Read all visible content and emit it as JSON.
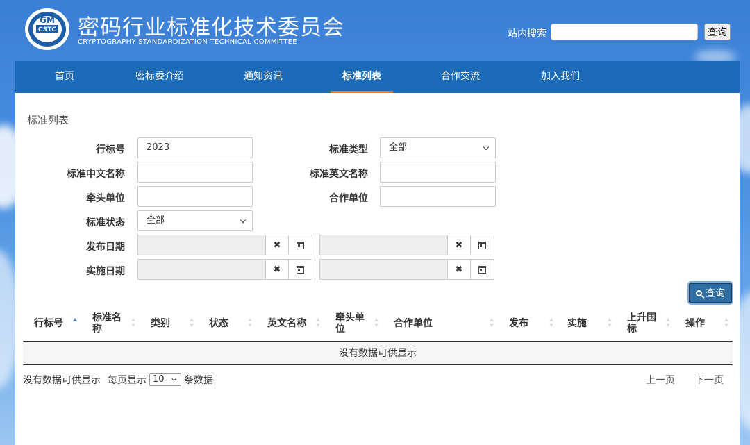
{
  "header": {
    "logo_text": "GM CSTC",
    "title": "密码行业标准化技术委员会",
    "subtitle": "CRYPTOGRAPHY STANDARDIZATION TECHNICAL COMMITTEE",
    "search_label": "站内搜索",
    "search_value": "",
    "search_button": "查询"
  },
  "nav": {
    "items": [
      {
        "label": "首页",
        "active": false
      },
      {
        "label": "密标委介绍",
        "active": false
      },
      {
        "label": "通知资讯",
        "active": false
      },
      {
        "label": "标准列表",
        "active": true
      },
      {
        "label": "合作交流",
        "active": false
      },
      {
        "label": "加入我们",
        "active": false
      }
    ]
  },
  "main": {
    "page_title": "标准列表",
    "filters": {
      "industry_no_label": "行标号",
      "industry_no_value": "2023",
      "std_type_label": "标准类型",
      "std_type_value": "全部",
      "cn_name_label": "标准中文名称",
      "cn_name_value": "",
      "en_name_label": "标准英文名称",
      "en_name_value": "",
      "lead_unit_label": "牵头单位",
      "lead_unit_value": "",
      "coop_unit_label": "合作单位",
      "coop_unit_value": "",
      "status_label": "标准状态",
      "status_value": "全部",
      "publish_date_label": "发布日期",
      "implement_date_label": "实施日期",
      "clear_icon": "times-icon",
      "calendar_icon": "calendar-icon"
    },
    "query_button": "查询",
    "table": {
      "columns": [
        "行标号",
        "标准名称",
        "类别",
        "状态",
        "英文名称",
        "牵头单位",
        "合作单位",
        "发布",
        "实施",
        "上升国标",
        "操作"
      ],
      "empty_text": "没有数据可供显示"
    },
    "footer": {
      "info": "没有数据可供显示",
      "per_page_prefix": "每页显示",
      "per_page_value": "10",
      "per_page_suffix": "条数据",
      "prev": "上一页",
      "next": "下一页"
    }
  },
  "colors": {
    "nav_bg": "#1c6bb8",
    "active_underline": "#f07b2b",
    "query_button_bg": "#2e6da4"
  }
}
